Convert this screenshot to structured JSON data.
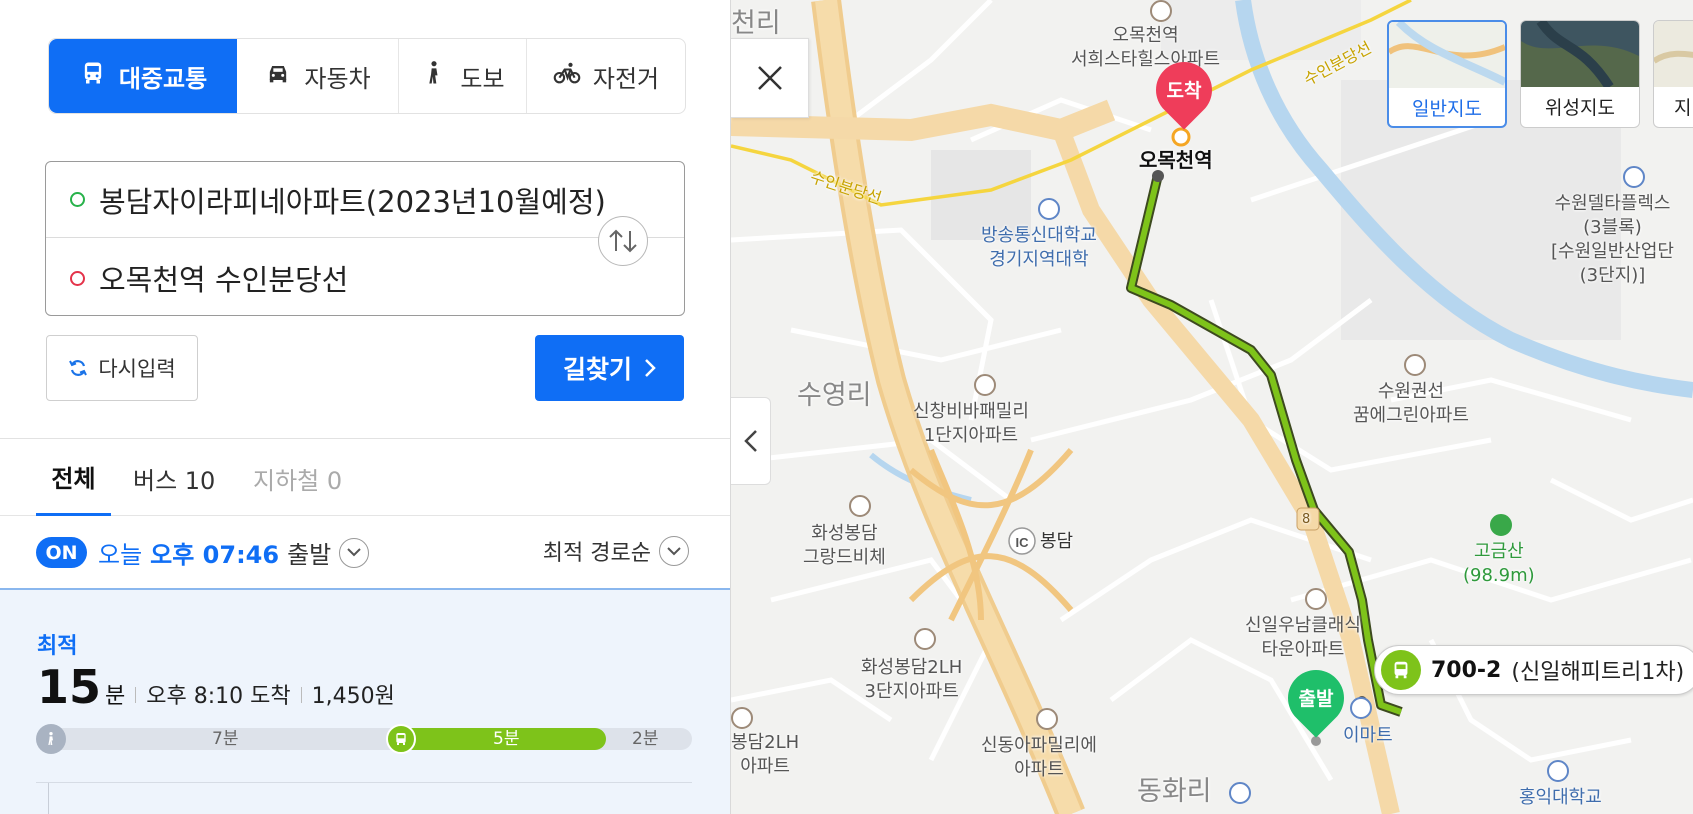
{
  "modes": [
    {
      "label": "대중교통",
      "icon": "bus-icon",
      "active": true
    },
    {
      "label": "자동차",
      "icon": "car-icon",
      "active": false
    },
    {
      "label": "도보",
      "icon": "walk-icon",
      "active": false
    },
    {
      "label": "자전거",
      "icon": "bike-icon",
      "active": false
    }
  ],
  "route": {
    "origin": "봉담자이라피네아파트(2023년10월예정)",
    "destination": "오목천역 수인분당선"
  },
  "buttons": {
    "reset": "다시입력",
    "search": "길찾기"
  },
  "tabs": [
    {
      "label": "전체"
    },
    {
      "label": "버스 10"
    },
    {
      "label": "지하철 0"
    }
  ],
  "departure": {
    "badge": "ON",
    "day": "오늘",
    "time": "오후 07:46",
    "suffix": "출발",
    "sort": "최적 경로순"
  },
  "result": {
    "tag": "최적",
    "duration": "15",
    "duration_unit": "분",
    "arrival": "오후 8:10 도착",
    "fare": "1,450원",
    "segments": {
      "walk": "7분",
      "bus": "5분",
      "end": "2분"
    }
  },
  "map": {
    "types": [
      {
        "label": "일반지도",
        "active": true
      },
      {
        "label": "위성지도",
        "active": false
      },
      {
        "label": "지",
        "active": false
      }
    ],
    "pins": {
      "start": "출발",
      "end": "도착"
    },
    "bus": {
      "number": "700-2",
      "destination": "(신일해피트리1차)"
    },
    "labels": {
      "area_top": "천리",
      "apt_omok": "오목천역\n서희스타힐스아파트",
      "line_top_right": "수인분당선",
      "line_left": "수인분당선",
      "station": "오목천역",
      "univ": "방송통신대학교\n경기지역대학",
      "delta": "수원델타플렉스\n(3블록)\n[수원일반산업단\n(3단지)]",
      "suyeong": "수영리",
      "sinchang": "신창비바패밀리\n1단지아파트",
      "suwon_apt": "수원권선\n꿈에그린아파트",
      "ic": "봉담",
      "gran": "화성봉담\n그랑드비체",
      "mountain": "고금산\n(98.9m)",
      "sinil": "신일우남클래식\n타운아파트",
      "lh3": "화성봉담2LH\n3단지아파트",
      "lh2": "봉담2LH\n아파트",
      "sindong": "신동아파밀리에\n아파트",
      "emart": "이마트",
      "donghwa": "동화리",
      "hongik": "홍익대학교",
      "route_no": "8"
    }
  }
}
